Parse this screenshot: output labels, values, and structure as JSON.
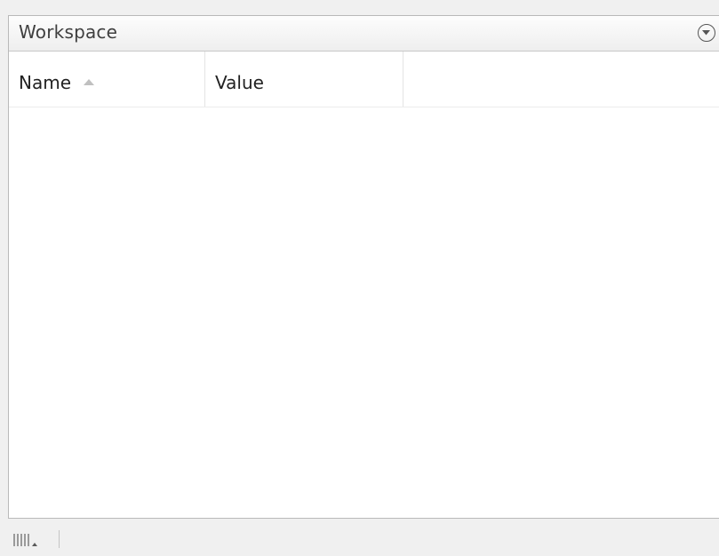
{
  "panel": {
    "title": "Workspace",
    "menu_icon": "circle-chevron-down-icon"
  },
  "table": {
    "columns": [
      {
        "label": "Name",
        "sort": "ascending"
      },
      {
        "label": "Value"
      }
    ],
    "rows": []
  },
  "statusbar": {
    "column_chooser_icon": "columns-icon",
    "dropdown_icon": "caret-up-icon"
  }
}
